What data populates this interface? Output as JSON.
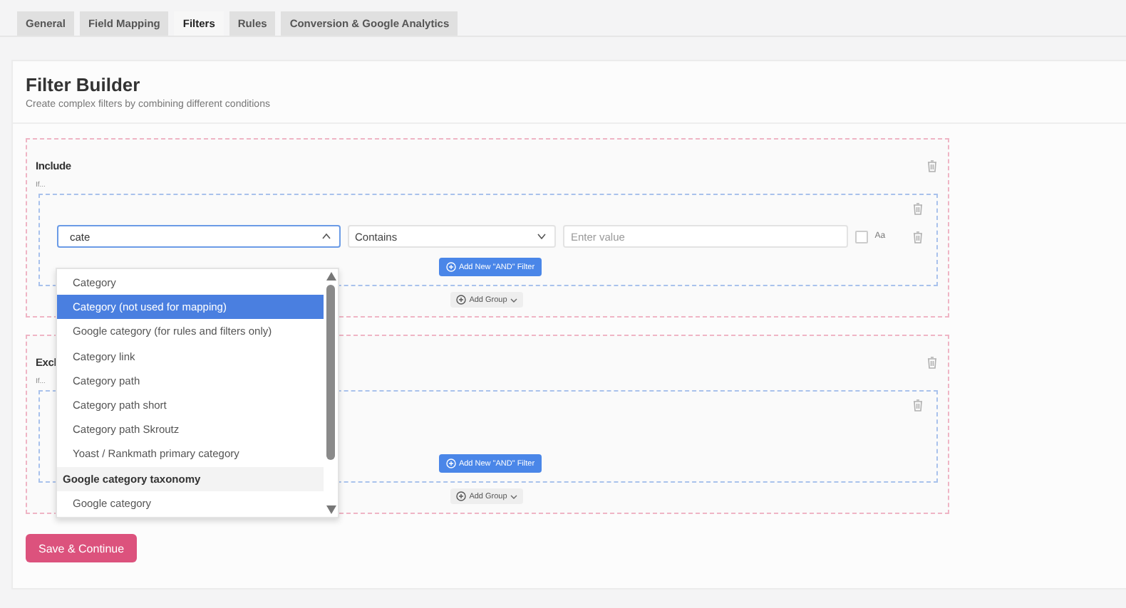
{
  "tabs": [
    {
      "label": "General",
      "selected": false
    },
    {
      "label": "Field Mapping",
      "selected": false
    },
    {
      "label": "Filters",
      "selected": true
    },
    {
      "label": "Rules",
      "selected": false
    },
    {
      "label": "Conversion & Google Analytics",
      "selected": false
    }
  ],
  "header": {
    "title": "Filter Builder",
    "subtitle": "Create complex filters by combining different conditions"
  },
  "sections": [
    {
      "title": "Include",
      "if_label": "If...",
      "groups": [
        {
          "rows": [
            {
              "field": {
                "value": "cate",
                "open": true
              },
              "operator": "Contains",
              "value_placeholder": "Enter value",
              "case_sensitive": false,
              "case_label": "Aa"
            }
          ],
          "add_filter": "Add New \"AND\" Filter"
        }
      ],
      "add_group": "Add Group"
    },
    {
      "title": "Excl",
      "if_label": "If...",
      "groups": [
        {
          "add_filter": "Add New \"AND\" Filter"
        }
      ],
      "add_group": "Add Group"
    }
  ],
  "dropdown": {
    "options": [
      {
        "kind": "option",
        "label": "Category",
        "selected": false
      },
      {
        "kind": "option",
        "label": "Category (not used for mapping)",
        "selected": true
      },
      {
        "kind": "option",
        "label": "Google category (for rules and filters only)",
        "selected": false
      },
      {
        "kind": "option",
        "label": "Category link",
        "selected": false
      },
      {
        "kind": "option",
        "label": "Category path",
        "selected": false
      },
      {
        "kind": "option",
        "label": "Category path short",
        "selected": false
      },
      {
        "kind": "option",
        "label": "Category path Skroutz",
        "selected": false
      },
      {
        "kind": "option",
        "label": "Yoast / Rankmath primary category",
        "selected": false
      },
      {
        "kind": "header",
        "label": "Google category taxonomy"
      },
      {
        "kind": "option",
        "label": "Google category",
        "selected": false
      }
    ]
  },
  "save_button": "Save & Continue"
}
